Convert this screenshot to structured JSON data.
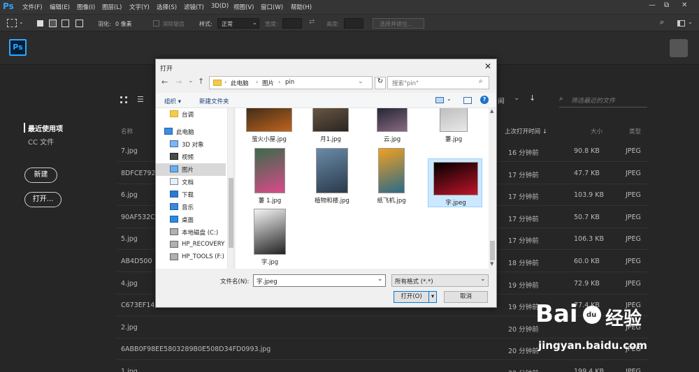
{
  "app": {
    "logo": "Ps",
    "menu": [
      "文件(F)",
      "编辑(E)",
      "图像(I)",
      "图层(L)",
      "文字(Y)",
      "选择(S)",
      "滤镜(T)",
      "3D(D)",
      "视图(V)",
      "窗口(W)",
      "帮助(H)"
    ],
    "window_controls": [
      "—",
      "⧉",
      "✕"
    ]
  },
  "options": {
    "feather_label": "羽化:",
    "feather_value": "0 像素",
    "antialias": "消除锯齿",
    "style_label": "样式:",
    "style_value": "正常",
    "width_label": "宽度:",
    "height_label": "高度:",
    "select_mask": "选择并遮住..."
  },
  "home": {
    "nav": {
      "recent": "最近使用项",
      "cc_files": "CC 文件"
    },
    "buttons": {
      "new": "新建",
      "open": "打开..."
    },
    "sort_partial": "间",
    "filter_placeholder": "筛选最近的文件",
    "columns": {
      "name": "名称",
      "opened": "上次打开时间 ↓",
      "size": "大小",
      "type": "类型"
    },
    "files": [
      {
        "name": "7.jpg",
        "opened": "16 分钟前",
        "size": "90.8 KB",
        "type": "JPEG"
      },
      {
        "name": "8DFCE792",
        "opened": "17 分钟前",
        "size": "47.7 KB",
        "type": "JPEG"
      },
      {
        "name": "6.jpg",
        "opened": "17 分钟前",
        "size": "103.9 KB",
        "type": "JPEG"
      },
      {
        "name": "90AF532C",
        "opened": "17 分钟前",
        "size": "50.7 KB",
        "type": "JPEG"
      },
      {
        "name": "5.jpg",
        "opened": "17 分钟前",
        "size": "106.3 KB",
        "type": "JPEG"
      },
      {
        "name": "AB4D500",
        "opened": "18 分钟前",
        "size": "60.0 KB",
        "type": "JPEG"
      },
      {
        "name": "4.jpg",
        "opened": "19 分钟前",
        "size": "72.9 KB",
        "type": "JPEG"
      },
      {
        "name": "C673EF14",
        "opened": "19 分钟前",
        "size": "77.4 KB",
        "type": "JPEG"
      },
      {
        "name": "2.jpg",
        "opened": "20 分钟前",
        "size": "",
        "type": "JPEG"
      },
      {
        "name": "6ABB0F98EE5803289B0E508D34FD0993.jpg",
        "opened": "20 分钟前",
        "size": "",
        "type": "JPEG"
      },
      {
        "name": "1.jpg",
        "opened": "22 分钟前",
        "size": "199.4 KB",
        "type": "JPEG"
      }
    ]
  },
  "dialog": {
    "title": "打开",
    "breadcrumb": [
      "此电脑",
      "图片",
      "pin"
    ],
    "search_placeholder": "搜索\"pin\"",
    "organize": "组织 ▾",
    "new_folder": "新建文件夹",
    "nav": [
      {
        "label": "台调",
        "icon": "folder-icon"
      },
      {
        "label": "此电脑",
        "icon": "computer-icon"
      },
      {
        "label": "3D 对象",
        "icon": "cube-icon"
      },
      {
        "label": "视频",
        "icon": "video-icon"
      },
      {
        "label": "图片",
        "icon": "picture-icon"
      },
      {
        "label": "文档",
        "icon": "document-icon"
      },
      {
        "label": "下载",
        "icon": "download-icon"
      },
      {
        "label": "音乐",
        "icon": "music-icon"
      },
      {
        "label": "桌面",
        "icon": "desktop-icon"
      },
      {
        "label": "本地磁盘 (C:)",
        "icon": "drive-icon"
      },
      {
        "label": "HP_RECOVERY",
        "icon": "drive-icon"
      },
      {
        "label": "HP_TOOLS (F:)",
        "icon": "drive-icon"
      }
    ],
    "thumbs": [
      {
        "name": "萤火小屋.jpg",
        "colors": [
          "#3a2a1a",
          "#c0641c"
        ]
      },
      {
        "name": "月1.jpg",
        "colors": [
          "#6b5a44",
          "#2a2420"
        ]
      },
      {
        "name": "云.jpg",
        "colors": [
          "#1e2230",
          "#8a6a80"
        ]
      },
      {
        "name": "萋.jpg",
        "colors": [
          "#bbbbbb",
          "#e8e8e8"
        ]
      },
      {
        "name": "萋 1.jpg",
        "colors": [
          "#3b6b4a",
          "#d94a8a"
        ]
      },
      {
        "name": "植物和楼.jpg",
        "colors": [
          "#6a8aa8",
          "#2a3a4a"
        ]
      },
      {
        "name": "纸飞机.jpg",
        "colors": [
          "#f0a020",
          "#2a6a8a"
        ]
      },
      {
        "name": "字.jpeg",
        "colors": [
          "#000000",
          "#c0142a"
        ]
      },
      {
        "name": "字.jpg",
        "colors": [
          "#f4f4f4",
          "#222222"
        ]
      }
    ],
    "filename_label": "文件名(N):",
    "filename_value": "字.jpeg",
    "filter_value": "所有格式 (*.*)",
    "open_button": "打开(O)",
    "cancel_button": "取消"
  },
  "watermark": {
    "brand": "Bai",
    "paw": "du",
    "jingyan": "经验",
    "url": "jingyan.baidu.com"
  }
}
